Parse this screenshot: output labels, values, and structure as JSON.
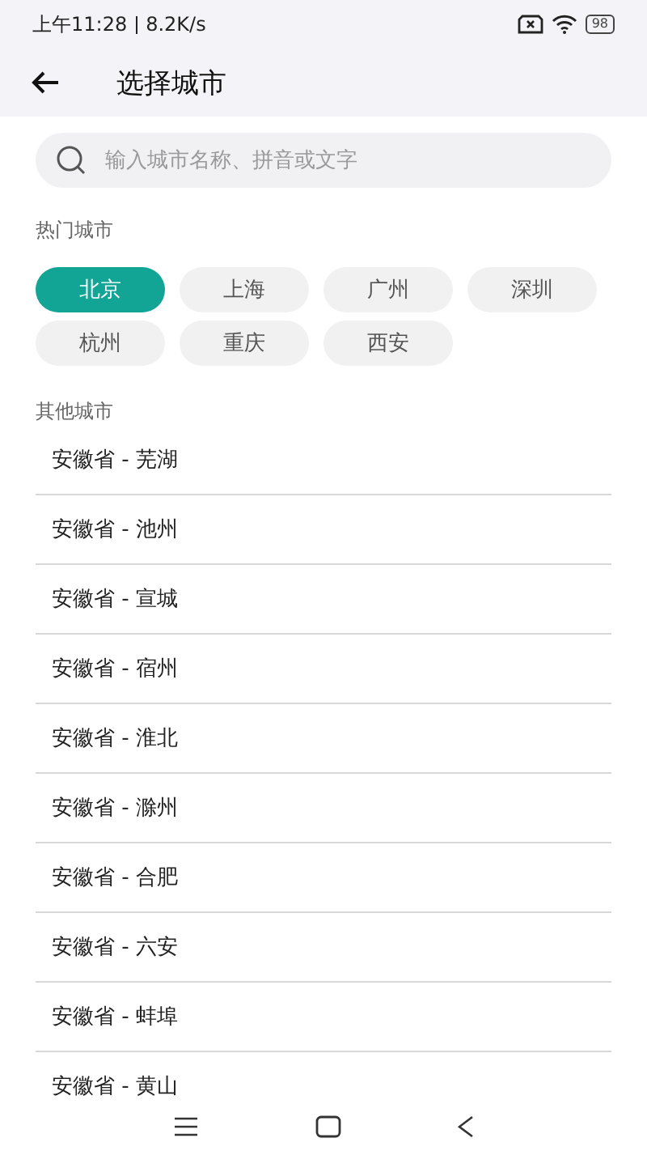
{
  "status_bar": {
    "time": "上午11:28",
    "speed": "8.2K/s",
    "battery": "98"
  },
  "header": {
    "title": "选择城市"
  },
  "search": {
    "placeholder": "输入城市名称、拼音或文字"
  },
  "hot_section": {
    "title": "热门城市",
    "cities": [
      {
        "label": "北京",
        "selected": true
      },
      {
        "label": "上海",
        "selected": false
      },
      {
        "label": "广州",
        "selected": false
      },
      {
        "label": "深圳",
        "selected": false
      },
      {
        "label": "杭州",
        "selected": false
      },
      {
        "label": "重庆",
        "selected": false
      },
      {
        "label": "西安",
        "selected": false
      }
    ]
  },
  "other_section": {
    "title": "其他城市",
    "cities": [
      "安徽省 - 芜湖",
      "安徽省 - 池州",
      "安徽省 - 宣城",
      "安徽省 - 宿州",
      "安徽省 - 淮北",
      "安徽省 - 滁州",
      "安徽省 - 合肥",
      "安徽省 - 六安",
      "安徽省 - 蚌埠",
      "安徽省 - 黄山"
    ]
  }
}
